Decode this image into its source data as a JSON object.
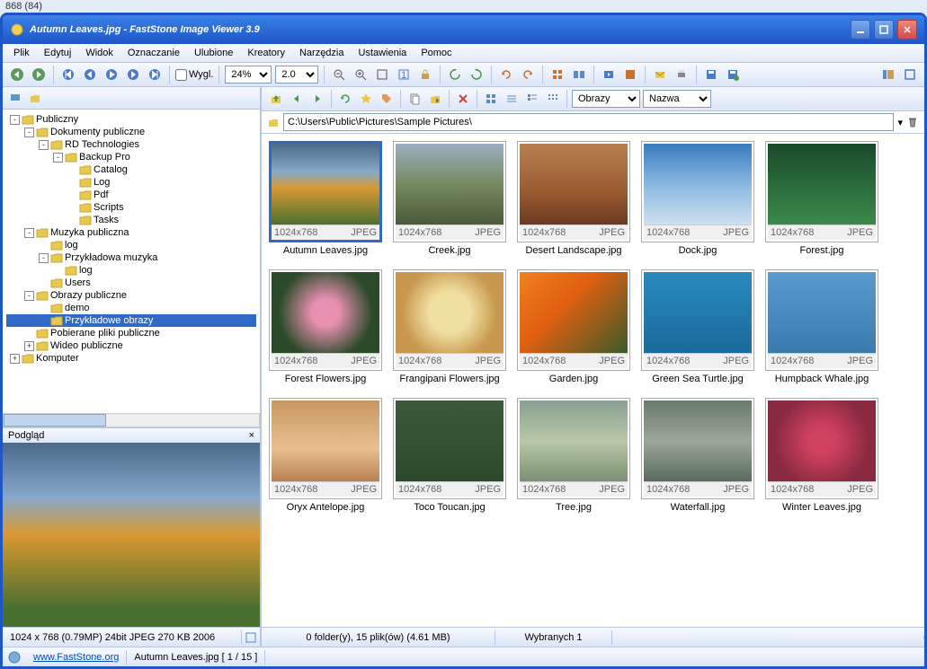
{
  "top_indicator": "868 (84)",
  "title": "Autumn Leaves.jpg  -  FastStone Image Viewer 3.9",
  "menu": [
    "Plik",
    "Edytuj",
    "Widok",
    "Oznaczanie",
    "Ulubione",
    "Kreatory",
    "Narzędzia",
    "Ustawienia",
    "Pomoc"
  ],
  "toolbar": {
    "view_label": "Wygl.",
    "zoom": "24%",
    "interval": "2.0"
  },
  "mtoolbar": {
    "view_filter": "Obrazy",
    "sort": "Nazwa"
  },
  "path": "C:\\Users\\Public\\Pictures\\Sample Pictures\\",
  "tree": [
    {
      "indent": 0,
      "expand": "-",
      "label": "Publiczny"
    },
    {
      "indent": 1,
      "expand": "-",
      "label": "Dokumenty publiczne"
    },
    {
      "indent": 2,
      "expand": "-",
      "label": "RD Technologies"
    },
    {
      "indent": 3,
      "expand": "-",
      "label": "Backup Pro"
    },
    {
      "indent": 4,
      "expand": "",
      "label": "Catalog"
    },
    {
      "indent": 4,
      "expand": "",
      "label": "Log"
    },
    {
      "indent": 4,
      "expand": "",
      "label": "Pdf"
    },
    {
      "indent": 4,
      "expand": "",
      "label": "Scripts"
    },
    {
      "indent": 4,
      "expand": "",
      "label": "Tasks"
    },
    {
      "indent": 1,
      "expand": "-",
      "label": "Muzyka publiczna"
    },
    {
      "indent": 2,
      "expand": "",
      "label": "log"
    },
    {
      "indent": 2,
      "expand": "-",
      "label": "Przykładowa muzyka"
    },
    {
      "indent": 3,
      "expand": "",
      "label": "log"
    },
    {
      "indent": 2,
      "expand": "",
      "label": "Users"
    },
    {
      "indent": 1,
      "expand": "-",
      "label": "Obrazy publiczne"
    },
    {
      "indent": 2,
      "expand": "",
      "label": "demo"
    },
    {
      "indent": 2,
      "expand": "",
      "label": "Przykładowe obrazy",
      "selected": true
    },
    {
      "indent": 1,
      "expand": "",
      "label": "Pobierane pliki publiczne"
    },
    {
      "indent": 1,
      "expand": "+",
      "label": "Wideo publiczne"
    },
    {
      "indent": 0,
      "expand": "+",
      "label": "Komputer"
    }
  ],
  "preview_header": "Podgląd",
  "thumbnails": [
    {
      "name": "Autumn Leaves.jpg",
      "dim": "1024x768",
      "fmt": "JPEG",
      "selected": true,
      "bg": "linear-gradient(180deg,#4a6a8a 0%,#87a8c8 35%,#d89830 55%,#4a7030 100%)"
    },
    {
      "name": "Creek.jpg",
      "dim": "1024x768",
      "fmt": "JPEG",
      "bg": "linear-gradient(180deg,#9aafc0 0%,#768a60 50%,#4a5a3a 100%)"
    },
    {
      "name": "Desert Landscape.jpg",
      "dim": "1024x768",
      "fmt": "JPEG",
      "bg": "linear-gradient(180deg,#b88050 0%,#9a5a30 60%,#6a3a20 100%)"
    },
    {
      "name": "Dock.jpg",
      "dim": "1024x768",
      "fmt": "JPEG",
      "bg": "linear-gradient(180deg,#3a7ac0 0%,#88b8e0 50%,#d0e0f0 100%)"
    },
    {
      "name": "Forest.jpg",
      "dim": "1024x768",
      "fmt": "JPEG",
      "bg": "linear-gradient(180deg,#1a4a2a 0%,#2a6a3a 50%,#3a8a4a 100%)"
    },
    {
      "name": "Forest Flowers.jpg",
      "dim": "1024x768",
      "fmt": "JPEG",
      "bg": "radial-gradient(circle,#e890b0 20%,#2a4a2a 70%)"
    },
    {
      "name": "Frangipani Flowers.jpg",
      "dim": "1024x768",
      "fmt": "JPEG",
      "bg": "radial-gradient(circle,#f0e0a0 30%,#c89850 70%)"
    },
    {
      "name": "Garden.jpg",
      "dim": "1024x768",
      "fmt": "JPEG",
      "bg": "linear-gradient(135deg,#f08020 0%,#e06010 40%,#3a5a2a 100%)"
    },
    {
      "name": "Green Sea Turtle.jpg",
      "dim": "1024x768",
      "fmt": "JPEG",
      "bg": "linear-gradient(180deg,#2a8ac0 0%,#1a6a9a 100%)"
    },
    {
      "name": "Humpback Whale.jpg",
      "dim": "1024x768",
      "fmt": "JPEG",
      "bg": "linear-gradient(180deg,#5a9acc 0%,#3a7aac 100%)"
    },
    {
      "name": "Oryx Antelope.jpg",
      "dim": "1024x768",
      "fmt": "JPEG",
      "bg": "linear-gradient(180deg,#c89860 0%,#e8c090 60%,#b88050 100%)"
    },
    {
      "name": "Toco Toucan.jpg",
      "dim": "1024x768",
      "fmt": "JPEG",
      "bg": "linear-gradient(180deg,#3a5a3a 0%,#2a4a2a 100%)"
    },
    {
      "name": "Tree.jpg",
      "dim": "1024x768",
      "fmt": "JPEG",
      "bg": "linear-gradient(180deg,#8aa090 0%,#b8c8a8 50%,#7a9070 100%)"
    },
    {
      "name": "Waterfall.jpg",
      "dim": "1024x768",
      "fmt": "JPEG",
      "bg": "linear-gradient(180deg,#6a7a6a 0%,#9aa898 50%,#5a6a5a 100%)"
    },
    {
      "name": "Winter Leaves.jpg",
      "dim": "1024x768",
      "fmt": "JPEG",
      "bg": "radial-gradient(circle,#d04060 20%,#8a2a40 70%)"
    }
  ],
  "statusbar": {
    "left": "1024 x 768 (0.79MP)   24bit JPEG   270 KB   2006",
    "center": "0 folder(y), 15 plik(ów) (4.61 MB)",
    "right": "Wybranych 1",
    "site": "www.FastStone.org",
    "position": "Autumn Leaves.jpg [ 1 / 15 ]"
  }
}
